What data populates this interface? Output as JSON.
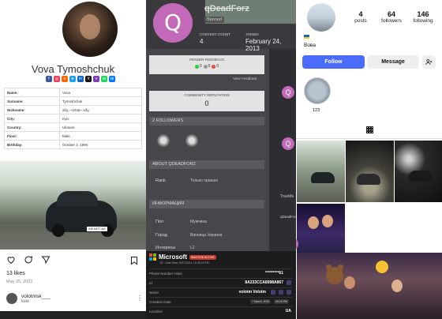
{
  "left": {
    "profile_name": "Vova Tymoshchuk",
    "info_rows": [
      {
        "k": "Name:",
        "v": "Vova"
      },
      {
        "k": "Surname:",
        "v": "Tymoshchuk"
      },
      {
        "k": "Nickname:",
        "v": "xßy, ~1Xüä~ xßy,"
      },
      {
        "k": "City:",
        "v": "Kyiv"
      },
      {
        "k": "Country:",
        "v": "Ukraine"
      },
      {
        "k": "Floor:",
        "v": "Male"
      },
      {
        "k": "Birthday:",
        "v": "October 2, 1994"
      }
    ],
    "car_plate": "KA 4477 AX",
    "likes": "13 likes",
    "post_date": "May 25, 2022",
    "comment_user": "volotmsk___",
    "comment_sub": "Київ",
    "social_colors": [
      "#3b5998",
      "#e4405f",
      "#ff6600",
      "#1da1f2",
      "#0a66c2",
      "#7d3daf",
      "#25d366",
      "#00acee",
      "#f57d00"
    ]
  },
  "mid": {
    "avatar_letter": "Q",
    "username": "qDeadForz",
    "banned_label": "Banned",
    "content_count_label": "CONTENT COUNT",
    "content_count_value": "4",
    "joined_label": "JOINED",
    "joined_value": "February 24, 2013",
    "trader_feedback_title": "TRADER FEEDBACK",
    "trader_feedback": [
      "0",
      "0",
      "0"
    ],
    "view_feedback": "View Feedback",
    "community_reputation_title": "COMMUNITY REPUTATION",
    "community_reputation_value": "0",
    "followers_title": "2 FOLLOWERS",
    "about_title": "ABOUT QDEADFORZ",
    "rank_k": "Rank",
    "rank_v": "Только пришел",
    "info_title": "ИНФОРМАЦИЯ",
    "sex_k": "Пол",
    "sex_v": "Мужчина",
    "city_k": "Город",
    "city_v": "Винница Украина",
    "interests_k": "Интересы",
    "interests_v": "L2",
    "trusted_1": "TrueMa",
    "trusted_2": "qDeadForz"
  },
  "ms": {
    "title": "Microsoft",
    "badge": "INACTIVE ACTIVE",
    "sub": "ID · Last Seen: 6/27/2024, 12:28:21 PM",
    "rows": [
      {
        "k": "Phone Number Hints",
        "v": "*********61"
      },
      {
        "k": "Id",
        "v": "8A233CCA8998A867"
      },
      {
        "k": "Name",
        "v": "volotm Volotm"
      },
      {
        "k": "Creation Date",
        "v": "7 March, 2020"
      },
      {
        "k": "Location",
        "v": "UA"
      }
    ],
    "creation_time": "05:16 PM"
  },
  "right": {
    "posts_count": "4",
    "posts_label": "posts",
    "followers_count": "64",
    "followers_label": "followers",
    "following_count": "146",
    "following_label": "following",
    "display_name": "Вова",
    "follow_label": "Follow",
    "message_label": "Message",
    "highlight_label": "123"
  }
}
